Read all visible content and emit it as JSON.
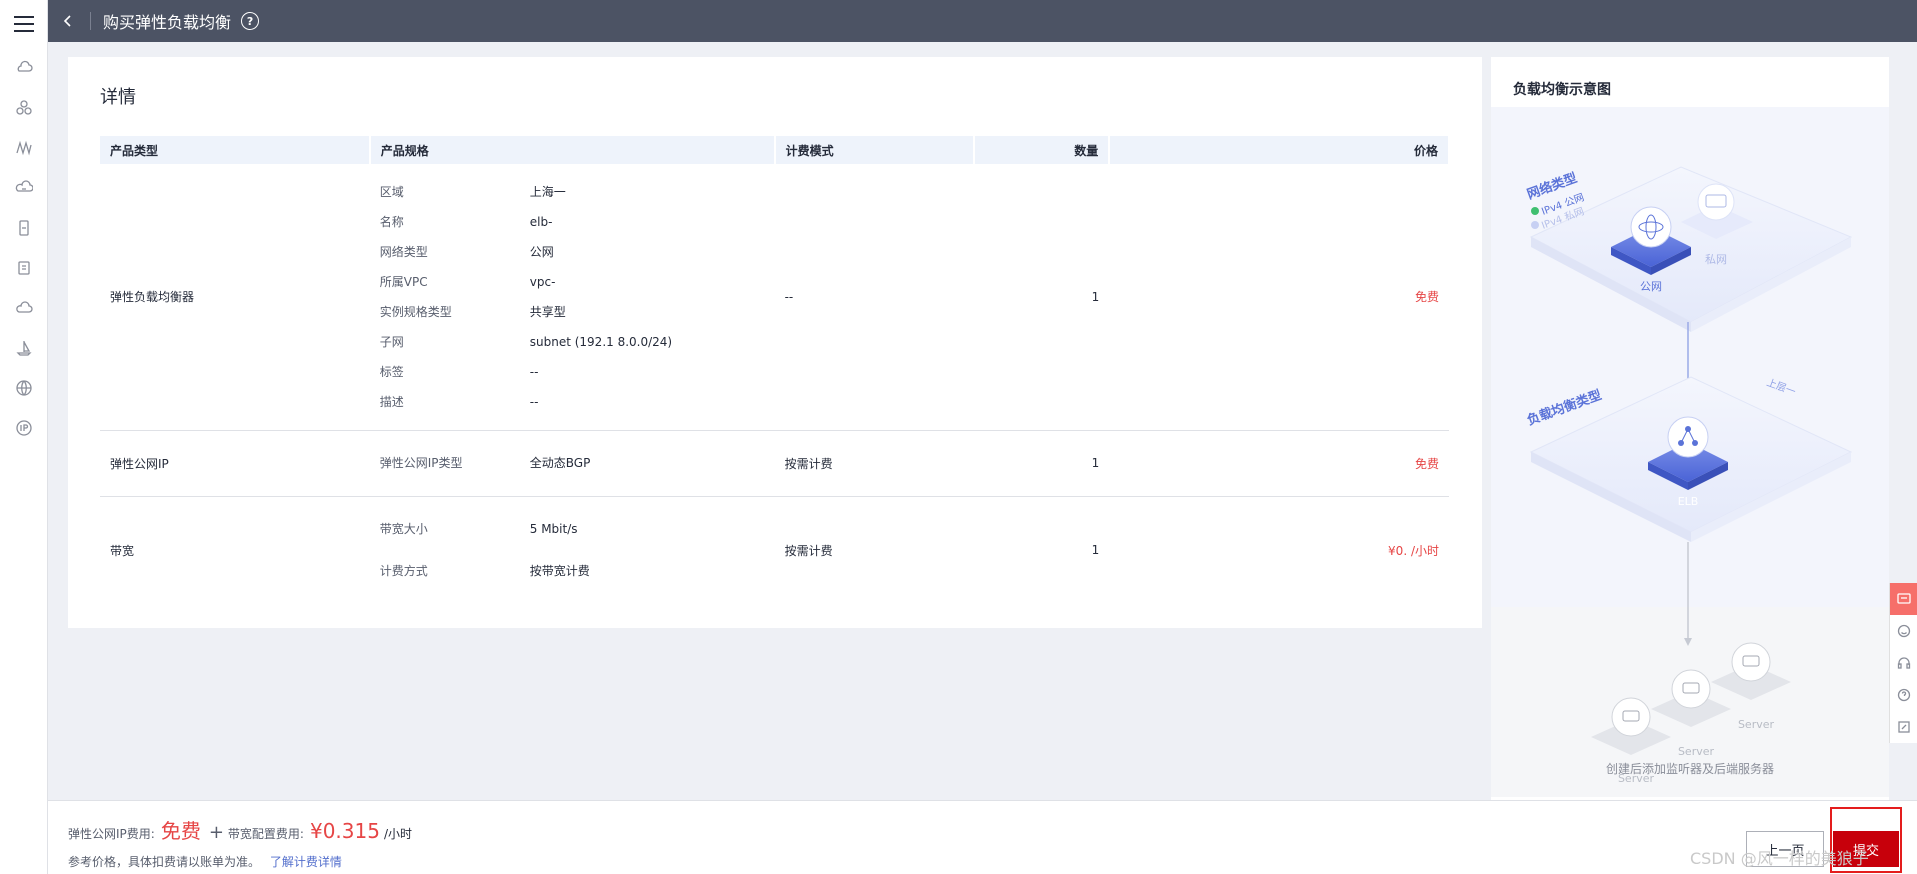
{
  "topbar": {
    "title": "购买弹性负载均衡",
    "help_glyph": "?"
  },
  "rail": {
    "icons": [
      "cloud-server-icon",
      "cluster-icon",
      "network-icon",
      "cloud-db-icon",
      "storage-icon",
      "container-icon",
      "cloud-icon",
      "sailboat-icon",
      "globe-icon",
      "ip-icon"
    ]
  },
  "details": {
    "title": "详情",
    "columns": {
      "product_type": "产品类型",
      "spec": "产品规格",
      "billing": "计费模式",
      "quantity": "数量",
      "price": "价格"
    },
    "rows": [
      {
        "product_type": "弹性负载均衡器",
        "specs": [
          {
            "k": "区域",
            "v": "上海一"
          },
          {
            "k": "名称",
            "v": "elb-"
          },
          {
            "k": "网络类型",
            "v": "公网"
          },
          {
            "k": "所属VPC",
            "v": "vpc-"
          },
          {
            "k": "实例规格类型",
            "v": "共享型"
          },
          {
            "k": "子网",
            "v": "subnet      (192.1 8.0.0/24)"
          },
          {
            "k": "标签",
            "v": "--"
          },
          {
            "k": "描述",
            "v": "--"
          }
        ],
        "billing": "--",
        "quantity": "1",
        "price": "免费"
      },
      {
        "product_type": "弹性公网IP",
        "specs": [
          {
            "k": "弹性公网IP类型",
            "v": "全动态BGP"
          }
        ],
        "billing": "按需计费",
        "quantity": "1",
        "price": "免费"
      },
      {
        "product_type": "带宽",
        "specs": [
          {
            "k": "带宽大小",
            "v": "5 Mbit/s"
          },
          {
            "k": "计费方式",
            "v": "按带宽计费"
          }
        ],
        "billing": "按需计费",
        "quantity": "1",
        "price": "¥0.  /小时"
      }
    ]
  },
  "diagram": {
    "title": "负载均衡示意图",
    "network_type_label": "网络类型",
    "ipv4_public": "IPv4 公网",
    "ipv4_private": "IPv4 私网",
    "public_label": "公网",
    "private_label": "私网",
    "lb_type_label": "负载均衡类型",
    "lb_tag": "上层一",
    "elb_label": "ELB",
    "server_label": "Server",
    "caption": "创建后添加监听器及后端服务器"
  },
  "footer": {
    "eip_fee_label": "弹性公网IP费用:",
    "eip_fee_value": "免费",
    "plus": "+",
    "bw_fee_label": "带宽配置费用:",
    "bw_fee_value": "¥0.315",
    "bw_fee_unit": "/小时",
    "reference_note": "参考价格，具体扣费请以账单为准。",
    "billing_link": "了解计费详情",
    "prev_button": "上一页",
    "submit_button": "提交"
  },
  "watermark": "CSDN @风一样的美狼子",
  "colors": {
    "topbar": "#4c5364",
    "accent_red": "#e64545",
    "submit_red": "#c7000b",
    "link_blue": "#526ecc",
    "diagram_blue": "#5b73d8"
  }
}
